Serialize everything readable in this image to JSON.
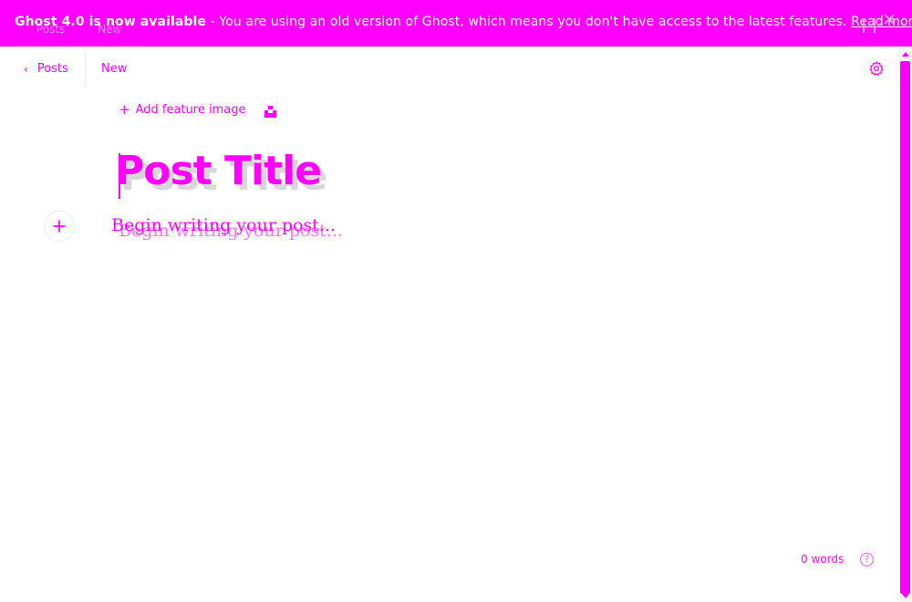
{
  "banner": {
    "headline": "Ghost 4.0 is now available",
    "message": " - You are using an old version of Ghost, which means you don't have access to the latest features. ",
    "link": "Read more!",
    "ghost_back": "Posts",
    "ghost_status": "New",
    "close_icon": "close-icon"
  },
  "toolbar": {
    "back_label": "Posts",
    "status": "New",
    "settings_icon": "gear-icon"
  },
  "editor": {
    "feature_image_label": "Add feature image",
    "title": "Post Title",
    "body_placeholder": "Begin writing your post...",
    "add_card_icon": "plus-icon"
  },
  "footer": {
    "word_count": "0 words",
    "help_label": "?"
  },
  "colors": {
    "accent": "#ff00ff",
    "background": "#ffffff"
  }
}
